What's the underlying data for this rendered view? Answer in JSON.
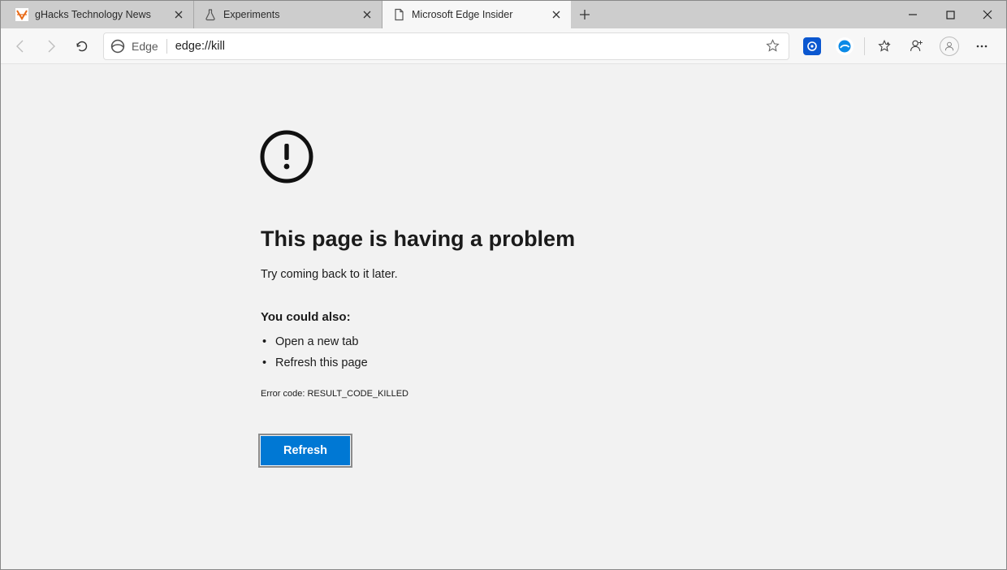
{
  "window": {
    "tabs": [
      {
        "title": "gHacks Technology News",
        "favicon": "ghacks",
        "active": false
      },
      {
        "title": "Experiments",
        "favicon": "flask",
        "active": false
      },
      {
        "title": "Microsoft Edge Insider",
        "favicon": "page",
        "active": true
      }
    ]
  },
  "toolbar": {
    "identity_label": "Edge",
    "url": "edge://kill"
  },
  "page": {
    "heading": "This page is having a problem",
    "subtext": "Try coming back to it later.",
    "also_heading": "You could also:",
    "suggestions": [
      "Open a new tab",
      "Refresh this page"
    ],
    "error_code": "Error code: RESULT_CODE_KILLED",
    "refresh_label": "Refresh"
  }
}
